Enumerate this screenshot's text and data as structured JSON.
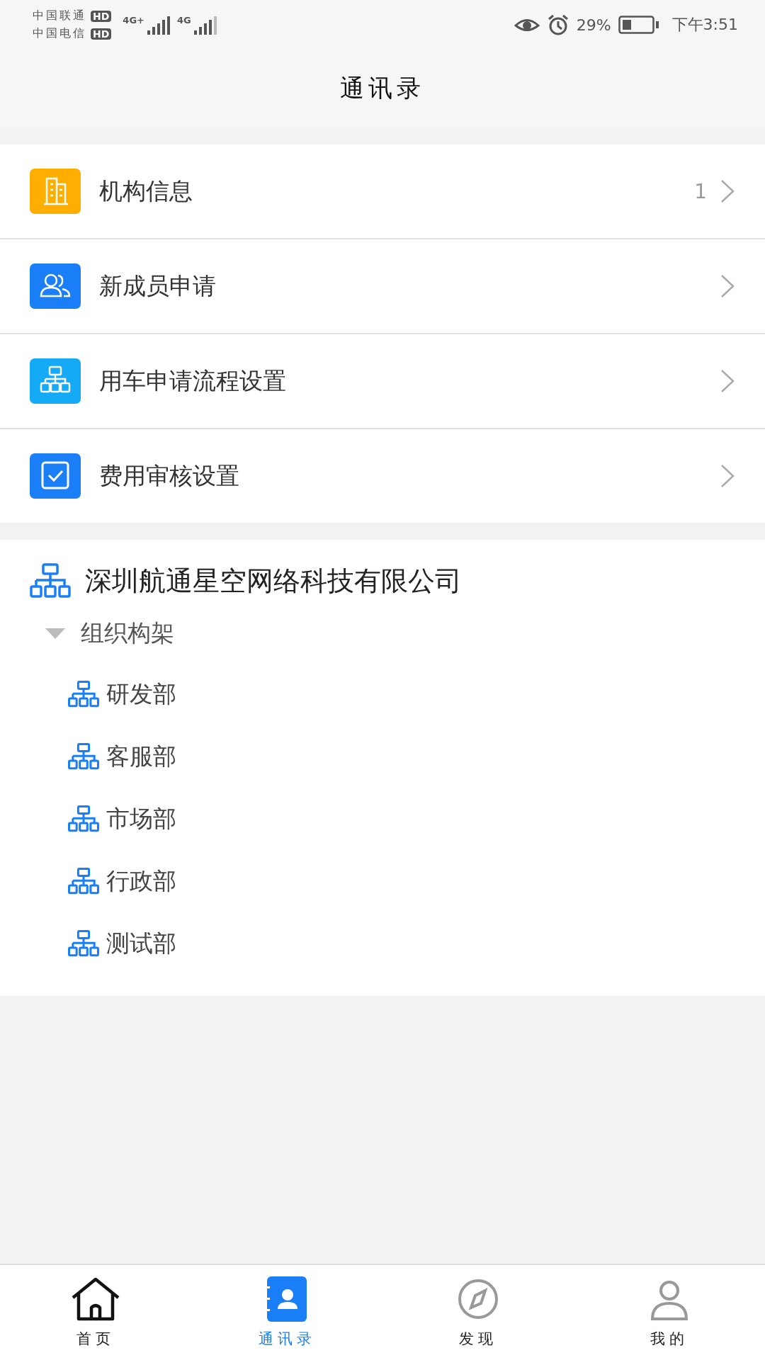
{
  "status_bar": {
    "carriers": [
      {
        "name": "中国联通",
        "badge": "HD",
        "network": "4G+"
      },
      {
        "name": "中国电信",
        "badge": "HD",
        "network": "4G"
      }
    ],
    "battery": "29%",
    "time": "下午3:51"
  },
  "header": {
    "title": "通讯录"
  },
  "menu": [
    {
      "label": "机构信息",
      "kind": "building",
      "count": "1"
    },
    {
      "label": "新成员申请",
      "kind": "people"
    },
    {
      "label": "用车申请流程设置",
      "kind": "org"
    },
    {
      "label": "费用审核设置",
      "kind": "check"
    }
  ],
  "organization": {
    "name": "深圳航通星空网络科技有限公司",
    "children": [
      {
        "label": "组织构架",
        "expanded": true,
        "children": [
          {
            "label": "研发部"
          },
          {
            "label": "客服部"
          },
          {
            "label": "市场部"
          },
          {
            "label": "行政部"
          },
          {
            "label": "测试部"
          }
        ]
      }
    ]
  },
  "tab_bar": [
    {
      "label": "首页",
      "kind": "home",
      "selected": false
    },
    {
      "label": "通讯录",
      "kind": "contacts",
      "selected": true
    },
    {
      "label": "发现",
      "kind": "compass",
      "selected": false
    },
    {
      "label": "我的",
      "kind": "person",
      "selected": false
    }
  ]
}
